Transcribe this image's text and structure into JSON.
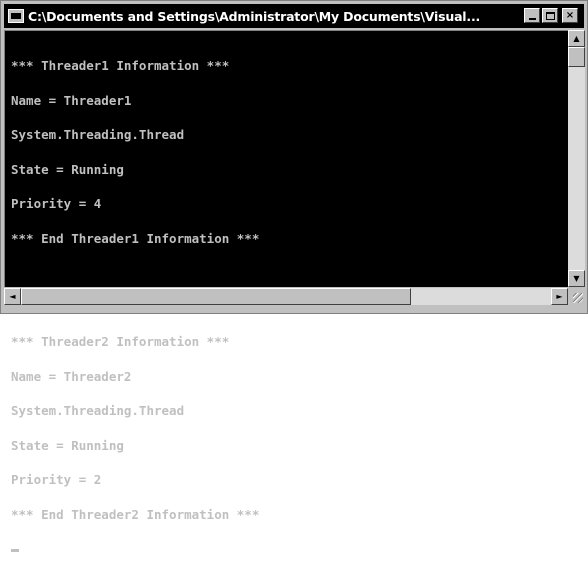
{
  "window": {
    "title": "C:\\Documents and Settings\\Administrator\\My Documents\\Visual...",
    "controls": {
      "minimize": "_",
      "maximize": "□",
      "close": "×"
    }
  },
  "console": {
    "lines": [
      "*** Threader1 Information ***",
      "Name = Threader1",
      "System.Threading.Thread",
      "State = Running",
      "Priority = 4",
      "*** End Threader1 Information ***",
      "",
      "",
      "*** Threader2 Information ***",
      "Name = Threader2",
      "System.Threading.Thread",
      "State = Running",
      "Priority = 2",
      "*** End Threader2 Information ***"
    ]
  },
  "scrollbars": {
    "up_arrow": "▲",
    "down_arrow": "▼",
    "left_arrow": "◄",
    "right_arrow": "►"
  },
  "icons": [
    "console-window-icon",
    "minimize-icon",
    "maximize-icon",
    "close-icon",
    "scroll-up-icon",
    "scroll-down-icon",
    "scroll-left-icon",
    "scroll-right-icon",
    "resize-grip-icon"
  ]
}
